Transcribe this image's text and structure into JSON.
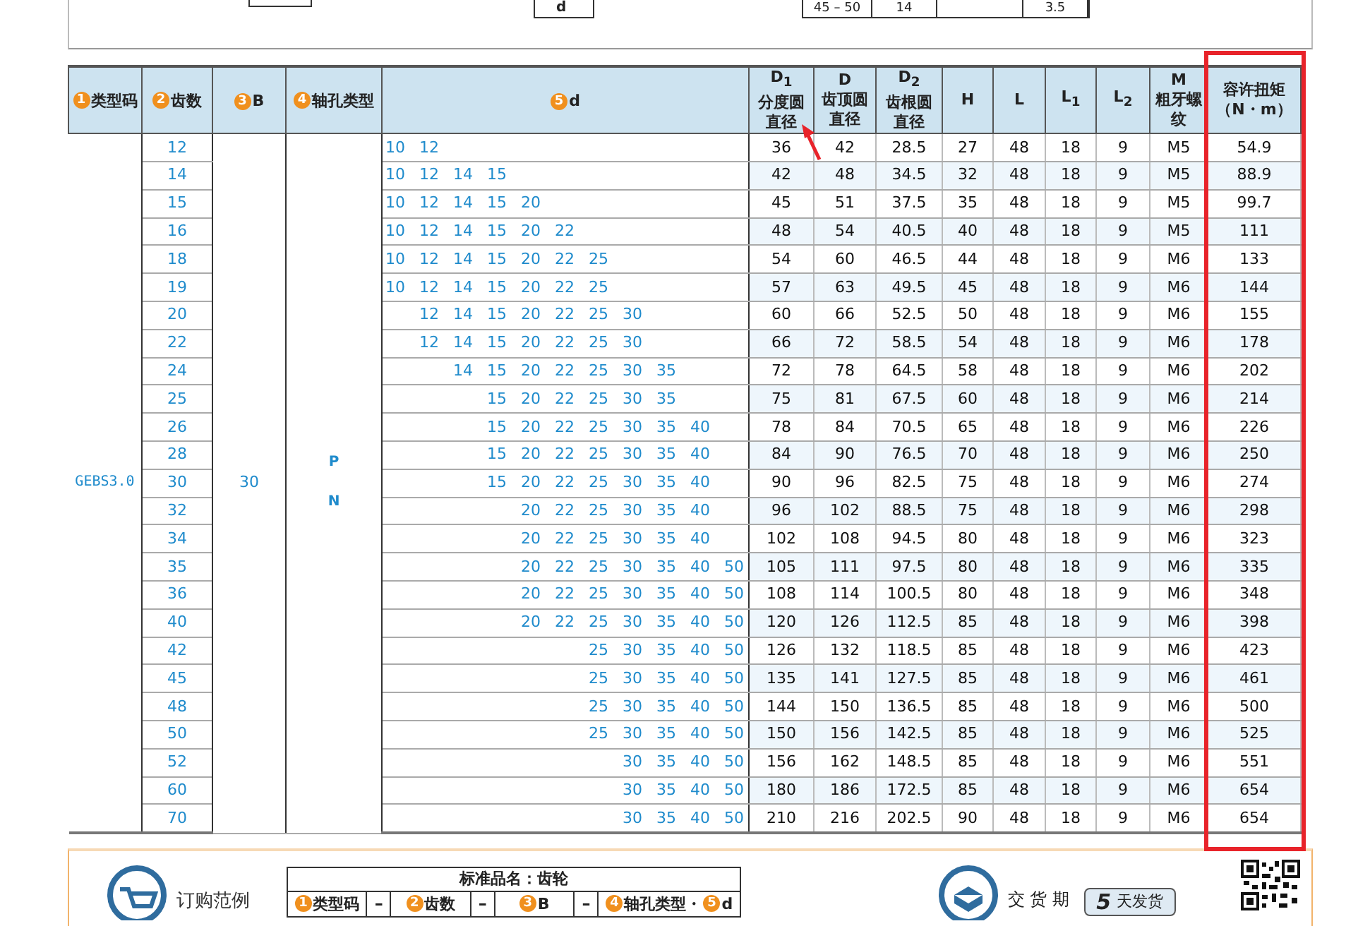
{
  "top_figure": {
    "dimension_label": "d",
    "spec_row": [
      "45 – 50",
      "14",
      "3.5"
    ]
  },
  "table": {
    "columns": [
      {
        "kind": "marked",
        "marker": "1",
        "label": "类型码"
      },
      {
        "kind": "marked",
        "marker": "2",
        "label": "齿数"
      },
      {
        "kind": "marked",
        "marker": "3",
        "label": "B"
      },
      {
        "kind": "marked",
        "marker": "4",
        "label": "轴孔类型"
      },
      {
        "kind": "marked",
        "marker": "5",
        "label": "d"
      },
      {
        "kind": "stacked",
        "lines": [
          "D$_{1}$",
          "分度圆",
          "直径"
        ]
      },
      {
        "kind": "stacked",
        "lines": [
          "D",
          "齿顶圆",
          "直径"
        ]
      },
      {
        "kind": "stacked",
        "lines": [
          "D$_{2}$",
          "齿根圆",
          "直径"
        ]
      },
      {
        "kind": "stacked",
        "lines": [
          "H"
        ]
      },
      {
        "kind": "stacked",
        "lines": [
          "L"
        ]
      },
      {
        "kind": "stacked",
        "lines": [
          "L$_{1}$"
        ]
      },
      {
        "kind": "stacked",
        "lines": [
          "L$_{2}$"
        ]
      },
      {
        "kind": "stacked",
        "lines": [
          "M",
          "粗牙螺纹"
        ]
      },
      {
        "kind": "stacked",
        "lines": [
          "容许扭矩",
          "（N・m）"
        ]
      }
    ],
    "type_code": "GEBS3.0",
    "b": "30",
    "bore_types": [
      "P",
      "N"
    ],
    "rows": [
      {
        "teeth": "12",
        "bores": [
          "10",
          "12"
        ],
        "specs": [
          "36",
          "42",
          "28.5",
          "27",
          "48",
          "18",
          "9",
          "M5"
        ],
        "torque": "54.9"
      },
      {
        "teeth": "14",
        "bores": [
          "10",
          "12",
          "14",
          "15"
        ],
        "specs": [
          "42",
          "48",
          "34.5",
          "32",
          "48",
          "18",
          "9",
          "M5"
        ],
        "torque": "88.9"
      },
      {
        "teeth": "15",
        "bores": [
          "10",
          "12",
          "14",
          "15",
          "20"
        ],
        "specs": [
          "45",
          "51",
          "37.5",
          "35",
          "48",
          "18",
          "9",
          "M5"
        ],
        "torque": "99.7"
      },
      {
        "teeth": "16",
        "bores": [
          "10",
          "12",
          "14",
          "15",
          "20",
          "22"
        ],
        "specs": [
          "48",
          "54",
          "40.5",
          "40",
          "48",
          "18",
          "9",
          "M5"
        ],
        "torque": "111"
      },
      {
        "teeth": "18",
        "bores": [
          "10",
          "12",
          "14",
          "15",
          "20",
          "22",
          "25"
        ],
        "specs": [
          "54",
          "60",
          "46.5",
          "44",
          "48",
          "18",
          "9",
          "M6"
        ],
        "torque": "133"
      },
      {
        "teeth": "19",
        "bores": [
          "10",
          "12",
          "14",
          "15",
          "20",
          "22",
          "25"
        ],
        "specs": [
          "57",
          "63",
          "49.5",
          "45",
          "48",
          "18",
          "9",
          "M6"
        ],
        "torque": "144"
      },
      {
        "teeth": "20",
        "bores": [
          "12",
          "14",
          "15",
          "20",
          "22",
          "25",
          "30"
        ],
        "specs": [
          "60",
          "66",
          "52.5",
          "50",
          "48",
          "18",
          "9",
          "M6"
        ],
        "torque": "155"
      },
      {
        "teeth": "22",
        "bores": [
          "12",
          "14",
          "15",
          "20",
          "22",
          "25",
          "30"
        ],
        "specs": [
          "66",
          "72",
          "58.5",
          "54",
          "48",
          "18",
          "9",
          "M6"
        ],
        "torque": "178"
      },
      {
        "teeth": "24",
        "bores": [
          "14",
          "15",
          "20",
          "22",
          "25",
          "30",
          "35"
        ],
        "specs": [
          "72",
          "78",
          "64.5",
          "58",
          "48",
          "18",
          "9",
          "M6"
        ],
        "torque": "202"
      },
      {
        "teeth": "25",
        "bores": [
          "15",
          "20",
          "22",
          "25",
          "30",
          "35"
        ],
        "specs": [
          "75",
          "81",
          "67.5",
          "60",
          "48",
          "18",
          "9",
          "M6"
        ],
        "torque": "214"
      },
      {
        "teeth": "26",
        "bores": [
          "15",
          "20",
          "22",
          "25",
          "30",
          "35",
          "40"
        ],
        "specs": [
          "78",
          "84",
          "70.5",
          "65",
          "48",
          "18",
          "9",
          "M6"
        ],
        "torque": "226"
      },
      {
        "teeth": "28",
        "bores": [
          "15",
          "20",
          "22",
          "25",
          "30",
          "35",
          "40"
        ],
        "specs": [
          "84",
          "90",
          "76.5",
          "70",
          "48",
          "18",
          "9",
          "M6"
        ],
        "torque": "250"
      },
      {
        "teeth": "30",
        "bores": [
          "15",
          "20",
          "22",
          "25",
          "30",
          "35",
          "40"
        ],
        "specs": [
          "90",
          "96",
          "82.5",
          "75",
          "48",
          "18",
          "9",
          "M6"
        ],
        "torque": "274"
      },
      {
        "teeth": "32",
        "bores": [
          "20",
          "22",
          "25",
          "30",
          "35",
          "40"
        ],
        "specs": [
          "96",
          "102",
          "88.5",
          "75",
          "48",
          "18",
          "9",
          "M6"
        ],
        "torque": "298"
      },
      {
        "teeth": "34",
        "bores": [
          "20",
          "22",
          "25",
          "30",
          "35",
          "40"
        ],
        "specs": [
          "102",
          "108",
          "94.5",
          "80",
          "48",
          "18",
          "9",
          "M6"
        ],
        "torque": "323"
      },
      {
        "teeth": "35",
        "bores": [
          "20",
          "22",
          "25",
          "30",
          "35",
          "40",
          "50"
        ],
        "specs": [
          "105",
          "111",
          "97.5",
          "80",
          "48",
          "18",
          "9",
          "M6"
        ],
        "torque": "335"
      },
      {
        "teeth": "36",
        "bores": [
          "20",
          "22",
          "25",
          "30",
          "35",
          "40",
          "50"
        ],
        "specs": [
          "108",
          "114",
          "100.5",
          "80",
          "48",
          "18",
          "9",
          "M6"
        ],
        "torque": "348"
      },
      {
        "teeth": "40",
        "bores": [
          "20",
          "22",
          "25",
          "30",
          "35",
          "40",
          "50"
        ],
        "specs": [
          "120",
          "126",
          "112.5",
          "85",
          "48",
          "18",
          "9",
          "M6"
        ],
        "torque": "398"
      },
      {
        "teeth": "42",
        "bores": [
          "25",
          "30",
          "35",
          "40",
          "50"
        ],
        "specs": [
          "126",
          "132",
          "118.5",
          "85",
          "48",
          "18",
          "9",
          "M6"
        ],
        "torque": "423"
      },
      {
        "teeth": "45",
        "bores": [
          "25",
          "30",
          "35",
          "40",
          "50"
        ],
        "specs": [
          "135",
          "141",
          "127.5",
          "85",
          "48",
          "18",
          "9",
          "M6"
        ],
        "torque": "461"
      },
      {
        "teeth": "48",
        "bores": [
          "25",
          "30",
          "35",
          "40",
          "50"
        ],
        "specs": [
          "144",
          "150",
          "136.5",
          "85",
          "48",
          "18",
          "9",
          "M6"
        ],
        "torque": "500"
      },
      {
        "teeth": "50",
        "bores": [
          "25",
          "30",
          "35",
          "40",
          "50"
        ],
        "specs": [
          "150",
          "156",
          "142.5",
          "85",
          "48",
          "18",
          "9",
          "M6"
        ],
        "torque": "525"
      },
      {
        "teeth": "52",
        "bores": [
          "30",
          "35",
          "40",
          "50"
        ],
        "specs": [
          "156",
          "162",
          "148.5",
          "85",
          "48",
          "18",
          "9",
          "M6"
        ],
        "torque": "551"
      },
      {
        "teeth": "60",
        "bores": [
          "30",
          "35",
          "40",
          "50"
        ],
        "specs": [
          "180",
          "186",
          "172.5",
          "85",
          "48",
          "18",
          "9",
          "M6"
        ],
        "torque": "654"
      },
      {
        "teeth": "70",
        "bores": [
          "30",
          "35",
          "40",
          "50"
        ],
        "specs": [
          "210",
          "216",
          "202.5",
          "90",
          "48",
          "18",
          "9",
          "M6"
        ],
        "torque": "654"
      }
    ]
  },
  "annotations": {
    "highlight_frame": true,
    "arrow": true
  },
  "order_example": {
    "title": "订购范例",
    "table_title": "标准品名：齿轮",
    "fields": [
      {
        "kind": "field",
        "parts": [
          {
            "marker": "1",
            "label": "类型码"
          }
        ]
      },
      {
        "kind": "dash",
        "text": "–"
      },
      {
        "kind": "field",
        "parts": [
          {
            "marker": "2",
            "label": "齿数"
          }
        ]
      },
      {
        "kind": "dash",
        "text": "–"
      },
      {
        "kind": "field",
        "parts": [
          {
            "marker": "3",
            "label": "B"
          }
        ]
      },
      {
        "kind": "dash",
        "text": "–"
      },
      {
        "kind": "field",
        "parts": [
          {
            "marker": "4",
            "label": "轴孔类型・"
          },
          {
            "marker": "5",
            "label": "d"
          }
        ]
      }
    ]
  },
  "delivery": {
    "title": "交 货 期",
    "days": "5",
    "unit": "天发货"
  }
}
